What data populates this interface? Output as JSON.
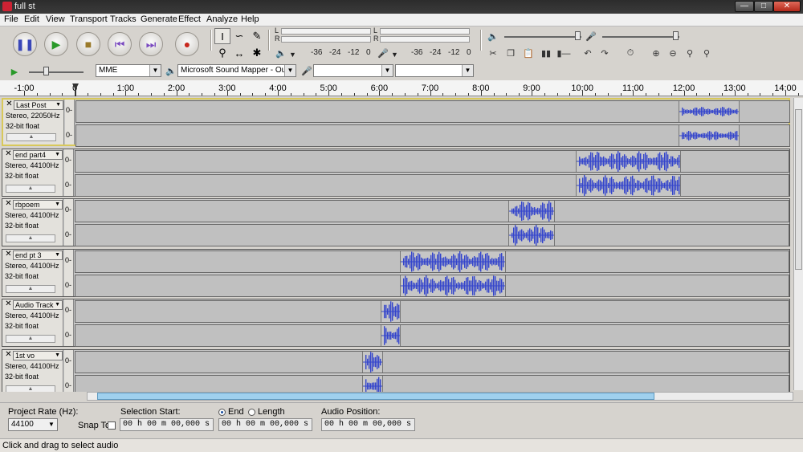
{
  "window": {
    "title": "full st"
  },
  "menu": [
    "File",
    "Edit",
    "View",
    "Transport",
    "Tracks",
    "Generate",
    "Effect",
    "Analyze",
    "Help"
  ],
  "meters": {
    "lr": [
      "L",
      "R"
    ],
    "ticks": [
      "-36",
      "-24",
      "-12",
      "0"
    ]
  },
  "device": {
    "host": "MME",
    "output": "Microsoft Sound Mapper - Output",
    "input": "",
    "channels": ""
  },
  "ruler": {
    "labels": [
      "-1:00",
      "0",
      "1:00",
      "2:00",
      "3:00",
      "4:00",
      "5:00",
      "6:00",
      "7:00",
      "8:00",
      "9:00",
      "10:00",
      "11:00",
      "12:00",
      "13:00",
      "14:00"
    ]
  },
  "tracks": [
    {
      "name": "Last Post",
      "format": "Stereo, 22050Hz",
      "depth": "32-bit float",
      "selected": true,
      "vlabel": "0-"
    },
    {
      "name": "end part4",
      "format": "Stereo, 44100Hz",
      "depth": "32-bit float",
      "selected": false,
      "vlabel": "0-"
    },
    {
      "name": "rbpoem",
      "format": "Stereo, 44100Hz",
      "depth": "32-bit float",
      "selected": false,
      "vlabel": "0-"
    },
    {
      "name": "end pt 3",
      "format": "Stereo, 44100Hz",
      "depth": "32-bit float",
      "selected": false,
      "vlabel": "0-"
    },
    {
      "name": "Audio Track",
      "format": "Stereo, 44100Hz",
      "depth": "32-bit float",
      "selected": false,
      "vlabel": "0-"
    },
    {
      "name": "1st vo",
      "format": "Stereo, 44100Hz",
      "depth": "32-bit float",
      "selected": false,
      "vlabel": "0-"
    }
  ],
  "selection": {
    "project_rate_label": "Project Rate (Hz):",
    "project_rate": "44100",
    "snap_to": "Snap To",
    "selection_start_label": "Selection Start:",
    "end_label": "End",
    "length_label": "Length",
    "audio_position_label": "Audio Position:",
    "start_value": "00 h 00 m 00,000 s",
    "end_value": "00 h 00 m 00,000 s",
    "position_value": "00 h 00 m 00,000 s"
  },
  "status": "Click and drag to select audio",
  "colors": {
    "waveform": "#3344cc",
    "selected_border": "#d8c85a"
  }
}
